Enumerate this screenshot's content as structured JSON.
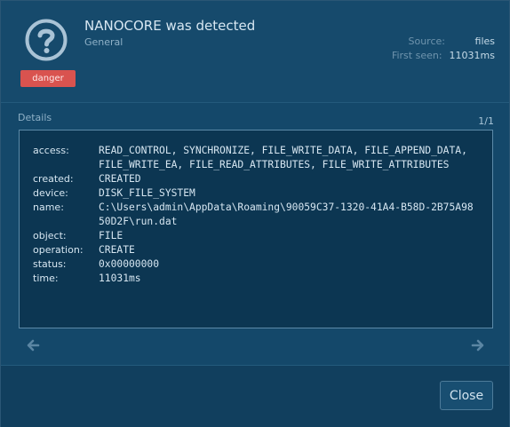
{
  "signature": {
    "icon": "question-icon",
    "severity": "danger",
    "title": "NANOCORE was detected",
    "category": "General",
    "source_label": "Source:",
    "source_value": "files",
    "first_seen_label": "First seen:",
    "first_seen_value": "11031ms"
  },
  "details": {
    "label": "Details",
    "pager": "1/1",
    "fields": [
      {
        "key": "access:",
        "value": "READ_CONTROL, SYNCHRONIZE, FILE_WRITE_DATA, FILE_APPEND_DATA, FILE_WRITE_EA, FILE_READ_ATTRIBUTES, FILE_WRITE_ATTRIBUTES"
      },
      {
        "key": "created:",
        "value": "CREATED"
      },
      {
        "key": "device:",
        "value": "DISK_FILE_SYSTEM"
      },
      {
        "key": "name:",
        "value": "C:\\Users\\admin\\AppData\\Roaming\\90059C37-1320-41A4-B58D-2B75A9850D2F\\run.dat"
      },
      {
        "key": "object:",
        "value": "FILE"
      },
      {
        "key": "operation:",
        "value": "CREATE"
      },
      {
        "key": "status:",
        "value": "0x00000000"
      },
      {
        "key": "time:",
        "value": "11031ms"
      }
    ]
  },
  "nav": {
    "prev_icon": "arrow-left-icon",
    "next_icon": "arrow-right-icon"
  },
  "footer": {
    "close_label": "Close"
  },
  "colors": {
    "danger": "#d9534f",
    "background": "#14486a",
    "panel": "#0c3652"
  }
}
